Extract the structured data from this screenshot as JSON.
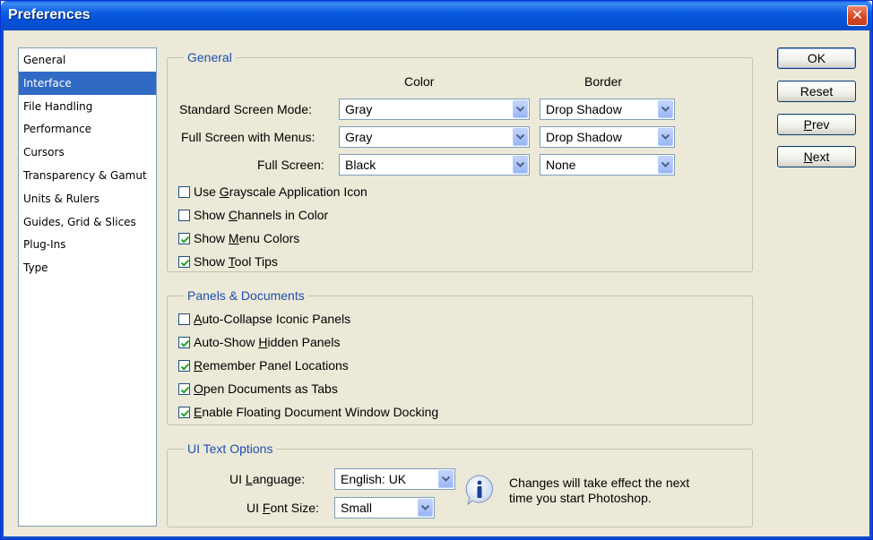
{
  "window": {
    "title": "Preferences"
  },
  "sidebar": {
    "items": [
      {
        "label": "General"
      },
      {
        "label": "Interface"
      },
      {
        "label": "File Handling"
      },
      {
        "label": "Performance"
      },
      {
        "label": "Cursors"
      },
      {
        "label": "Transparency & Gamut"
      },
      {
        "label": "Units & Rulers"
      },
      {
        "label": "Guides, Grid & Slices"
      },
      {
        "label": "Plug-Ins"
      },
      {
        "label": "Type"
      }
    ],
    "selected": "Interface"
  },
  "general": {
    "title": "General",
    "color_header": "Color",
    "border_header": "Border",
    "rows": [
      {
        "label": "Standard Screen Mode:",
        "color": "Gray",
        "border": "Drop Shadow"
      },
      {
        "label": "Full Screen with Menus:",
        "color": "Gray",
        "border": "Drop Shadow"
      },
      {
        "label": "Full Screen:",
        "color": "Black",
        "border": "None"
      }
    ],
    "checkboxes": [
      {
        "pre": "Use ",
        "u": "G",
        "post": "rayscale Application Icon",
        "checked": false
      },
      {
        "pre": "Show ",
        "u": "C",
        "post": "hannels in Color",
        "checked": false
      },
      {
        "pre": "Show ",
        "u": "M",
        "post": "enu Colors",
        "checked": true
      },
      {
        "pre": "Show ",
        "u": "T",
        "post": "ool Tips",
        "checked": true
      }
    ]
  },
  "panels": {
    "title": "Panels & Documents",
    "checkboxes": [
      {
        "pre": "",
        "u": "A",
        "post": "uto-Collapse Iconic Panels",
        "checked": false
      },
      {
        "pre": "Auto-Show ",
        "u": "H",
        "post": "idden Panels",
        "checked": true
      },
      {
        "pre": "",
        "u": "R",
        "post": "emember Panel Locations",
        "checked": true
      },
      {
        "pre": "",
        "u": "O",
        "post": "pen Documents as Tabs",
        "checked": true
      },
      {
        "pre": "",
        "u": "E",
        "post": "nable Floating Document Window Docking",
        "checked": true
      }
    ]
  },
  "ui_text": {
    "title": "UI Text Options",
    "language_label_pre": "UI ",
    "language_label_u": "L",
    "language_label_post": "anguage:",
    "language_value": "English: UK",
    "font_size_label_pre": "UI ",
    "font_size_label_u": "F",
    "font_size_label_post": "ont Size:",
    "font_size_value": "Small",
    "info_line1": "Changes will take effect the next",
    "info_line2": "time you start Photoshop."
  },
  "buttons": {
    "ok": "OK",
    "reset": "Reset",
    "prev_u": "P",
    "prev_rest": "rev",
    "next_u": "N",
    "next_rest": "ext"
  },
  "colors": {
    "titlebar": "#0a5fe3",
    "selection": "#316ac5",
    "group_title": "#1c4fb0"
  }
}
